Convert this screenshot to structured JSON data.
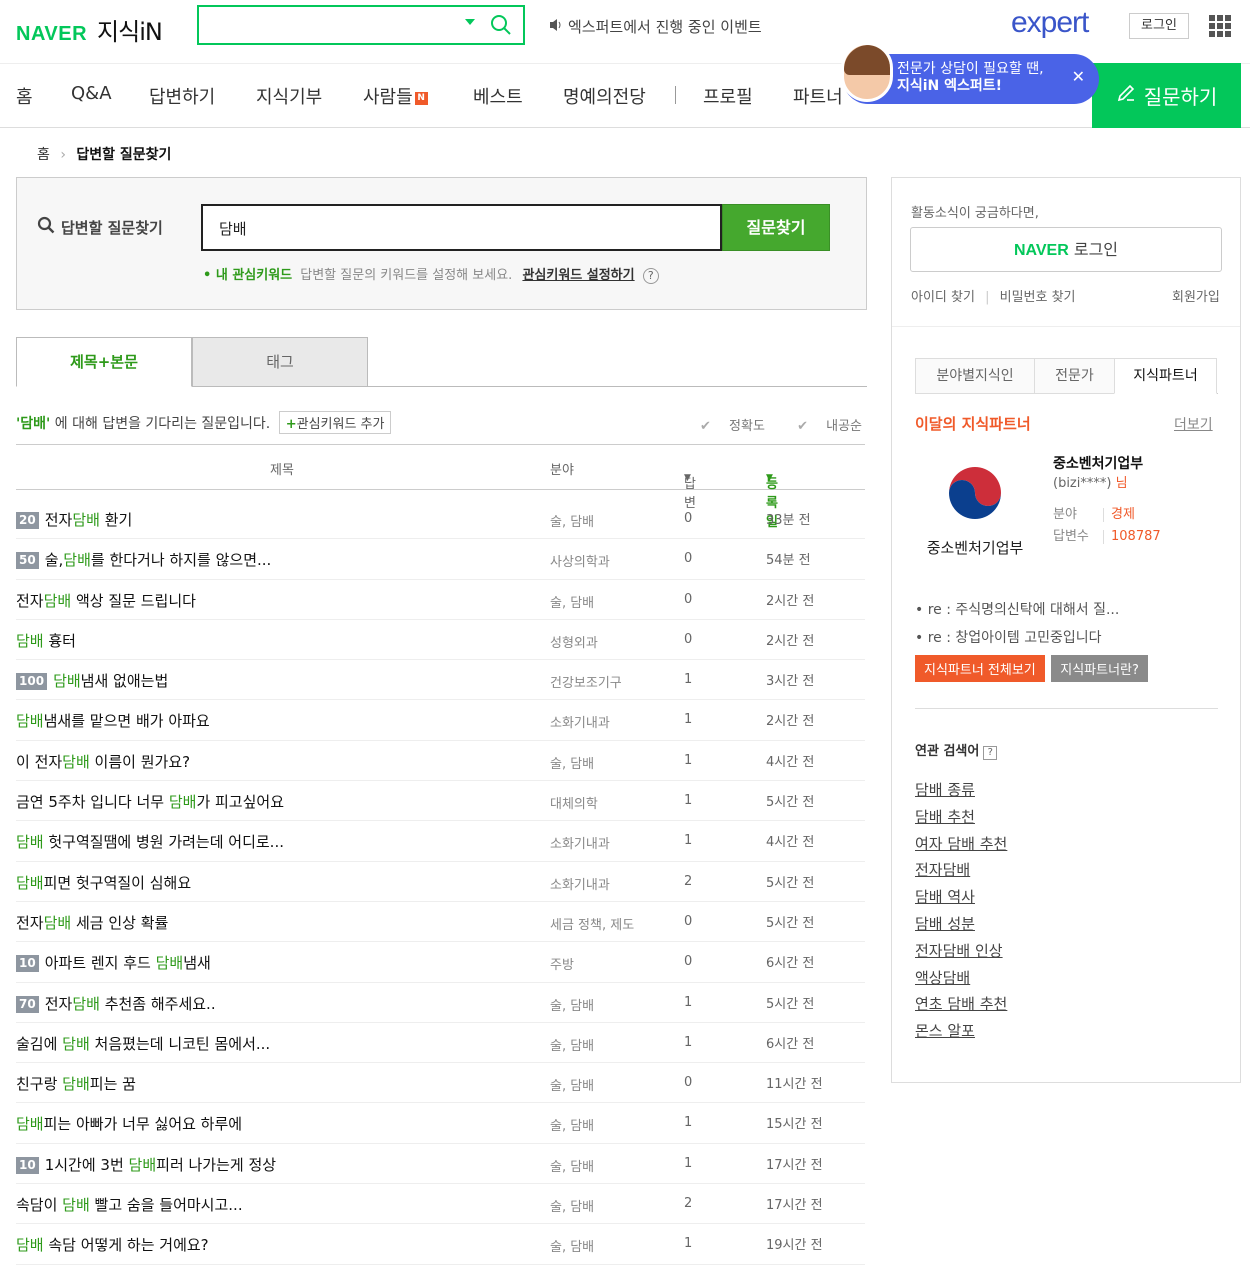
{
  "header": {
    "logo_naver": "NAVER",
    "logo_kin": "지식iN",
    "search_value": "",
    "event_text": "엑스퍼트에서 진행 중인 이벤트",
    "expert_logo": "expert",
    "login_label": "로그인",
    "icons": {
      "search": "search-icon",
      "apps": "apps-grid-icon",
      "speaker": "speaker-icon"
    }
  },
  "nav": {
    "items": [
      "홈",
      "Q&A",
      "답변하기",
      "지식기부",
      "사람들",
      "베스트",
      "명예의전당",
      "프로필",
      "파트너"
    ],
    "new_badge": "N",
    "ask_label": "질문하기"
  },
  "bubble": {
    "line1": "전문가 상담이 필요할 땐,",
    "line2": "지식iN 엑스퍼트!",
    "close": "✕"
  },
  "breadcrumb": {
    "home": "홈",
    "current": "답변할 질문찾기"
  },
  "searchbox": {
    "label": "답변할 질문찾기",
    "query": "담배",
    "button": "질문찾기",
    "hint_prefix": "• 내 관심키워드",
    "hint_text": "답변할 질문의 키워드를 설정해 보세요.",
    "hint_link": "관심키워드 설정하기",
    "help": "?"
  },
  "tabs": {
    "active": "제목+본문",
    "inactive": "태그"
  },
  "info": {
    "keyword": "'담배'",
    "text": "에 대해 답변을 기다리는 질문입니다.",
    "add_keyword": "관심키워드 추가",
    "sort_accuracy": "정확도",
    "sort_content": "내공순"
  },
  "table": {
    "headers": {
      "title": "제목",
      "category": "분야",
      "answers": "답변",
      "date": "등록일"
    },
    "keyword": "담배",
    "rows": [
      {
        "points": "20",
        "pre": "전자",
        "post": " 환기",
        "category": "술, 담배",
        "answers": "0",
        "date": "33분 전"
      },
      {
        "points": "50",
        "pre": "술,",
        "post": "를 한다거나 하지를 않으면...",
        "category": "사상의학과",
        "answers": "0",
        "date": "54분 전"
      },
      {
        "points": "",
        "pre": "전자",
        "post": " 액상 질문 드립니다",
        "category": "술, 담배",
        "answers": "0",
        "date": "2시간 전"
      },
      {
        "points": "",
        "pre": "",
        "post": " 흉터",
        "category": "성형외과",
        "answers": "0",
        "date": "2시간 전"
      },
      {
        "points": "100",
        "pre": "",
        "post": "냄새 없애는법",
        "category": "건강보조기구",
        "answers": "1",
        "date": "3시간 전"
      },
      {
        "points": "",
        "pre": "",
        "post": "냄새를 맡으면 배가 아파요",
        "category": "소화기내과",
        "answers": "1",
        "date": "2시간 전"
      },
      {
        "points": "",
        "pre": "이 전자",
        "post": " 이름이 뭔가요?",
        "category": "술, 담배",
        "answers": "1",
        "date": "4시간 전"
      },
      {
        "points": "",
        "pre": "금연 5주차 입니다 너무 ",
        "post": "가 피고싶어요",
        "category": "대체의학",
        "answers": "1",
        "date": "5시간 전"
      },
      {
        "points": "",
        "pre": "",
        "post": " 헛구역질땜에 병원 가려는데 어디로...",
        "category": "소화기내과",
        "answers": "1",
        "date": "4시간 전"
      },
      {
        "points": "",
        "pre": "",
        "post": "피면 헛구역질이 심해요",
        "category": "소화기내과",
        "answers": "2",
        "date": "5시간 전"
      },
      {
        "points": "",
        "pre": "전자",
        "post": " 세금 인상 확률",
        "category": "세금 정책, 제도",
        "answers": "0",
        "date": "5시간 전"
      },
      {
        "points": "10",
        "pre": "아파트 렌지 후드 ",
        "post": "냄새",
        "category": "주방",
        "answers": "0",
        "date": "6시간 전"
      },
      {
        "points": "70",
        "pre": "전자",
        "post": " 추천좀 해주세요..",
        "category": "술, 담배",
        "answers": "1",
        "date": "5시간 전"
      },
      {
        "points": "",
        "pre": "술김에 ",
        "post": " 처음폈는데 니코틴 몸에서...",
        "category": "술, 담배",
        "answers": "1",
        "date": "6시간 전"
      },
      {
        "points": "",
        "pre": "친구랑 ",
        "post": "피는 꿈",
        "category": "술, 담배",
        "answers": "0",
        "date": "11시간 전"
      },
      {
        "points": "",
        "pre": "",
        "post": "피는 아빠가 너무 싫어요 하루에",
        "category": "술, 담배",
        "answers": "1",
        "date": "15시간 전"
      },
      {
        "points": "10",
        "pre": "1시간에 3번 ",
        "post": "피러 나가는게 정상",
        "category": "술, 담배",
        "answers": "1",
        "date": "17시간 전"
      },
      {
        "points": "",
        "pre": "속담이 ",
        "post": " 빨고 숨을 들어마시고...",
        "category": "술, 담배",
        "answers": "2",
        "date": "17시간 전"
      },
      {
        "points": "",
        "pre": "",
        "post": " 속담 어떻게 하는 거에요?",
        "category": "술, 담배",
        "answers": "1",
        "date": "19시간 전"
      }
    ]
  },
  "side": {
    "activity": "활동소식이 궁금하다면,",
    "naver_login_brand": "NAVER",
    "naver_login_text": " 로그인",
    "find_id": "아이디 찾기",
    "find_pw": "비밀번호 찾기",
    "join": "회원가입",
    "tabs": [
      "분야별지식인",
      "전문가",
      "지식파트너"
    ],
    "partner_title": "이달의 지식파트너",
    "more": "더보기",
    "partner_name": "중소벤처기업부",
    "partner_id": "(bizi****)",
    "partner_suffix": "님",
    "logo_text": "중소벤처기업부",
    "field_label": "분야",
    "field_value": "경제",
    "count_label": "답변수",
    "count_value": "108787",
    "questions": [
      "• re : 주식명의신탁에 대해서 질...",
      "• re : 창업아이템 고민중입니다"
    ],
    "btn_all": "지식파트너 전체보기",
    "btn_what": "지식파트너란?",
    "related_title": "연관 검색어",
    "related_help": "?",
    "related": [
      "담배 종류",
      "담배 추천",
      "여자 담배 추천",
      "전자담배",
      "담배 역사",
      "담배 성분",
      "전자담배 인상",
      "액상담배",
      "연초 담배 추천",
      "몬스 알포"
    ],
    "colors": {
      "orange": "#f05a2a",
      "gray": "#8a8a8a"
    }
  }
}
